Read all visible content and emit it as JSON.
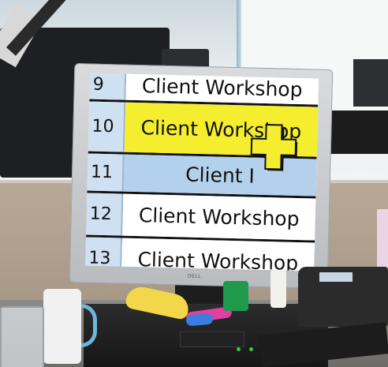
{
  "scene": {
    "description_role": "office desk with monitor showing magnified spreadsheet"
  },
  "spreadsheet": {
    "rows": [
      {
        "number": "9",
        "text": "Client Workshop",
        "style": "white"
      },
      {
        "number": "10",
        "text": "Client Workshop",
        "style": "yellow"
      },
      {
        "number": "11",
        "text": "Client I",
        "style": "blue"
      },
      {
        "number": "12",
        "text": "Client Workshop",
        "style": "white"
      },
      {
        "number": "13",
        "text": "Client Workshop",
        "style": "white"
      }
    ]
  },
  "monitor": {
    "brand_label": "DELL"
  },
  "colors": {
    "highlight_yellow": "#f4ee2e",
    "selection_blue": "#b3d1ec",
    "row_header_blue": "#cfe0f3",
    "cursor_fill": "#f4ee2e"
  },
  "icons": {
    "cursor": "plus-cross-cursor-icon"
  }
}
